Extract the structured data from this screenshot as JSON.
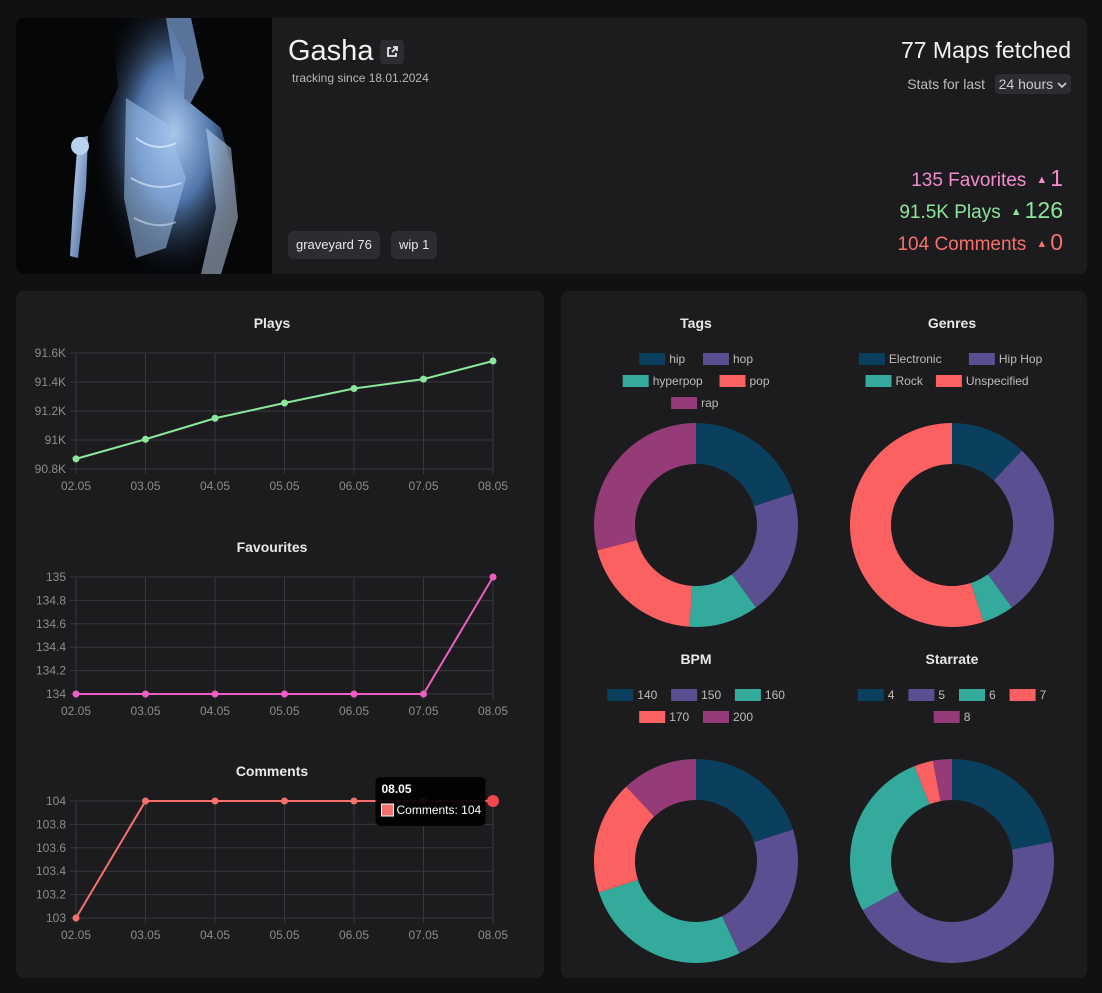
{
  "profile": {
    "username": "Gasha",
    "tracking_since": "tracking since 18.01.2024",
    "tags": [
      "graveyard 76",
      "wip 1"
    ],
    "maps_fetched": "77 Maps fetched",
    "stats_label": "Stats for last",
    "period": "24 hours",
    "stats": [
      {
        "label": "135 Favorites",
        "delta": "1",
        "color": "#f58bd0"
      },
      {
        "label": "91.5K Plays",
        "delta": "126",
        "color": "#8be79a"
      },
      {
        "label": "104 Comments",
        "delta": "0",
        "color": "#f6716e"
      }
    ]
  },
  "chart_data": [
    {
      "type": "line",
      "title": "Plays",
      "categories": [
        "02.05",
        "03.05",
        "04.05",
        "05.05",
        "06.05",
        "07.05",
        "08.05"
      ],
      "series": [
        {
          "values": [
            90870,
            91005,
            91150,
            91255,
            91355,
            91420,
            91545
          ],
          "color": "#8be79a"
        }
      ],
      "ylim": [
        90800,
        91600
      ],
      "ytick_values": [
        90800,
        91000,
        91200,
        91400,
        91600
      ],
      "yticks": [
        "90.8K",
        "91K",
        "91.2K",
        "91.4K",
        "91.6K"
      ],
      "grid": true
    },
    {
      "type": "line",
      "title": "Favourites",
      "categories": [
        "02.05",
        "03.05",
        "04.05",
        "05.05",
        "06.05",
        "07.05",
        "08.05"
      ],
      "series": [
        {
          "values": [
            134,
            134,
            134,
            134,
            134,
            134,
            135
          ],
          "color": "#ee5ec4"
        }
      ],
      "ylim": [
        134,
        135
      ],
      "ytick_values": [
        134,
        134.2,
        134.4,
        134.6,
        134.8,
        135
      ],
      "yticks": [
        "134",
        "134.2",
        "134.4",
        "134.6",
        "134.8",
        "135"
      ],
      "grid": true
    },
    {
      "type": "line",
      "title": "Comments",
      "categories": [
        "02.05",
        "03.05",
        "04.05",
        "05.05",
        "06.05",
        "07.05",
        "08.05"
      ],
      "series": [
        {
          "name": "Comments",
          "values": [
            103,
            104,
            104,
            104,
            104,
            104,
            104
          ],
          "color": "#f6716e"
        }
      ],
      "ylim": [
        103,
        104
      ],
      "ytick_values": [
        103,
        103.2,
        103.4,
        103.6,
        103.8,
        104
      ],
      "yticks": [
        "103",
        "103.2",
        "103.4",
        "103.6",
        "103.8",
        "104"
      ],
      "grid": true,
      "tooltip": {
        "title": "08.05",
        "text": "Comments: 104"
      }
    },
    {
      "type": "pie",
      "title": "Tags",
      "labels": [
        "hip",
        "hop",
        "hyperpop",
        "pop",
        "rap"
      ],
      "values": [
        20,
        20,
        11,
        20,
        29
      ],
      "colors": [
        "#0b3f5e",
        "#594f91",
        "#33aa9c",
        "#fa6160",
        "#953b78"
      ]
    },
    {
      "type": "pie",
      "title": "Genres",
      "labels": [
        "Electronic",
        "Hip Hop",
        "Rock",
        "Unspecified"
      ],
      "values": [
        12,
        28,
        5,
        55
      ],
      "colors": [
        "#0b3f5e",
        "#594f91",
        "#33aa9c",
        "#fa6160"
      ]
    },
    {
      "type": "pie",
      "title": "BPM",
      "labels": [
        "140",
        "150",
        "160",
        "170",
        "200"
      ],
      "values": [
        20,
        23,
        27,
        18,
        12
      ],
      "colors": [
        "#0b3f5e",
        "#594f91",
        "#33aa9c",
        "#fa6160",
        "#953b78"
      ]
    },
    {
      "type": "pie",
      "title": "Starrate",
      "labels": [
        "4",
        "5",
        "6",
        "7",
        "8"
      ],
      "values": [
        22,
        45,
        27,
        3,
        3
      ],
      "colors": [
        "#0b3f5e",
        "#594f91",
        "#33aa9c",
        "#fa6160",
        "#953b78"
      ]
    }
  ]
}
